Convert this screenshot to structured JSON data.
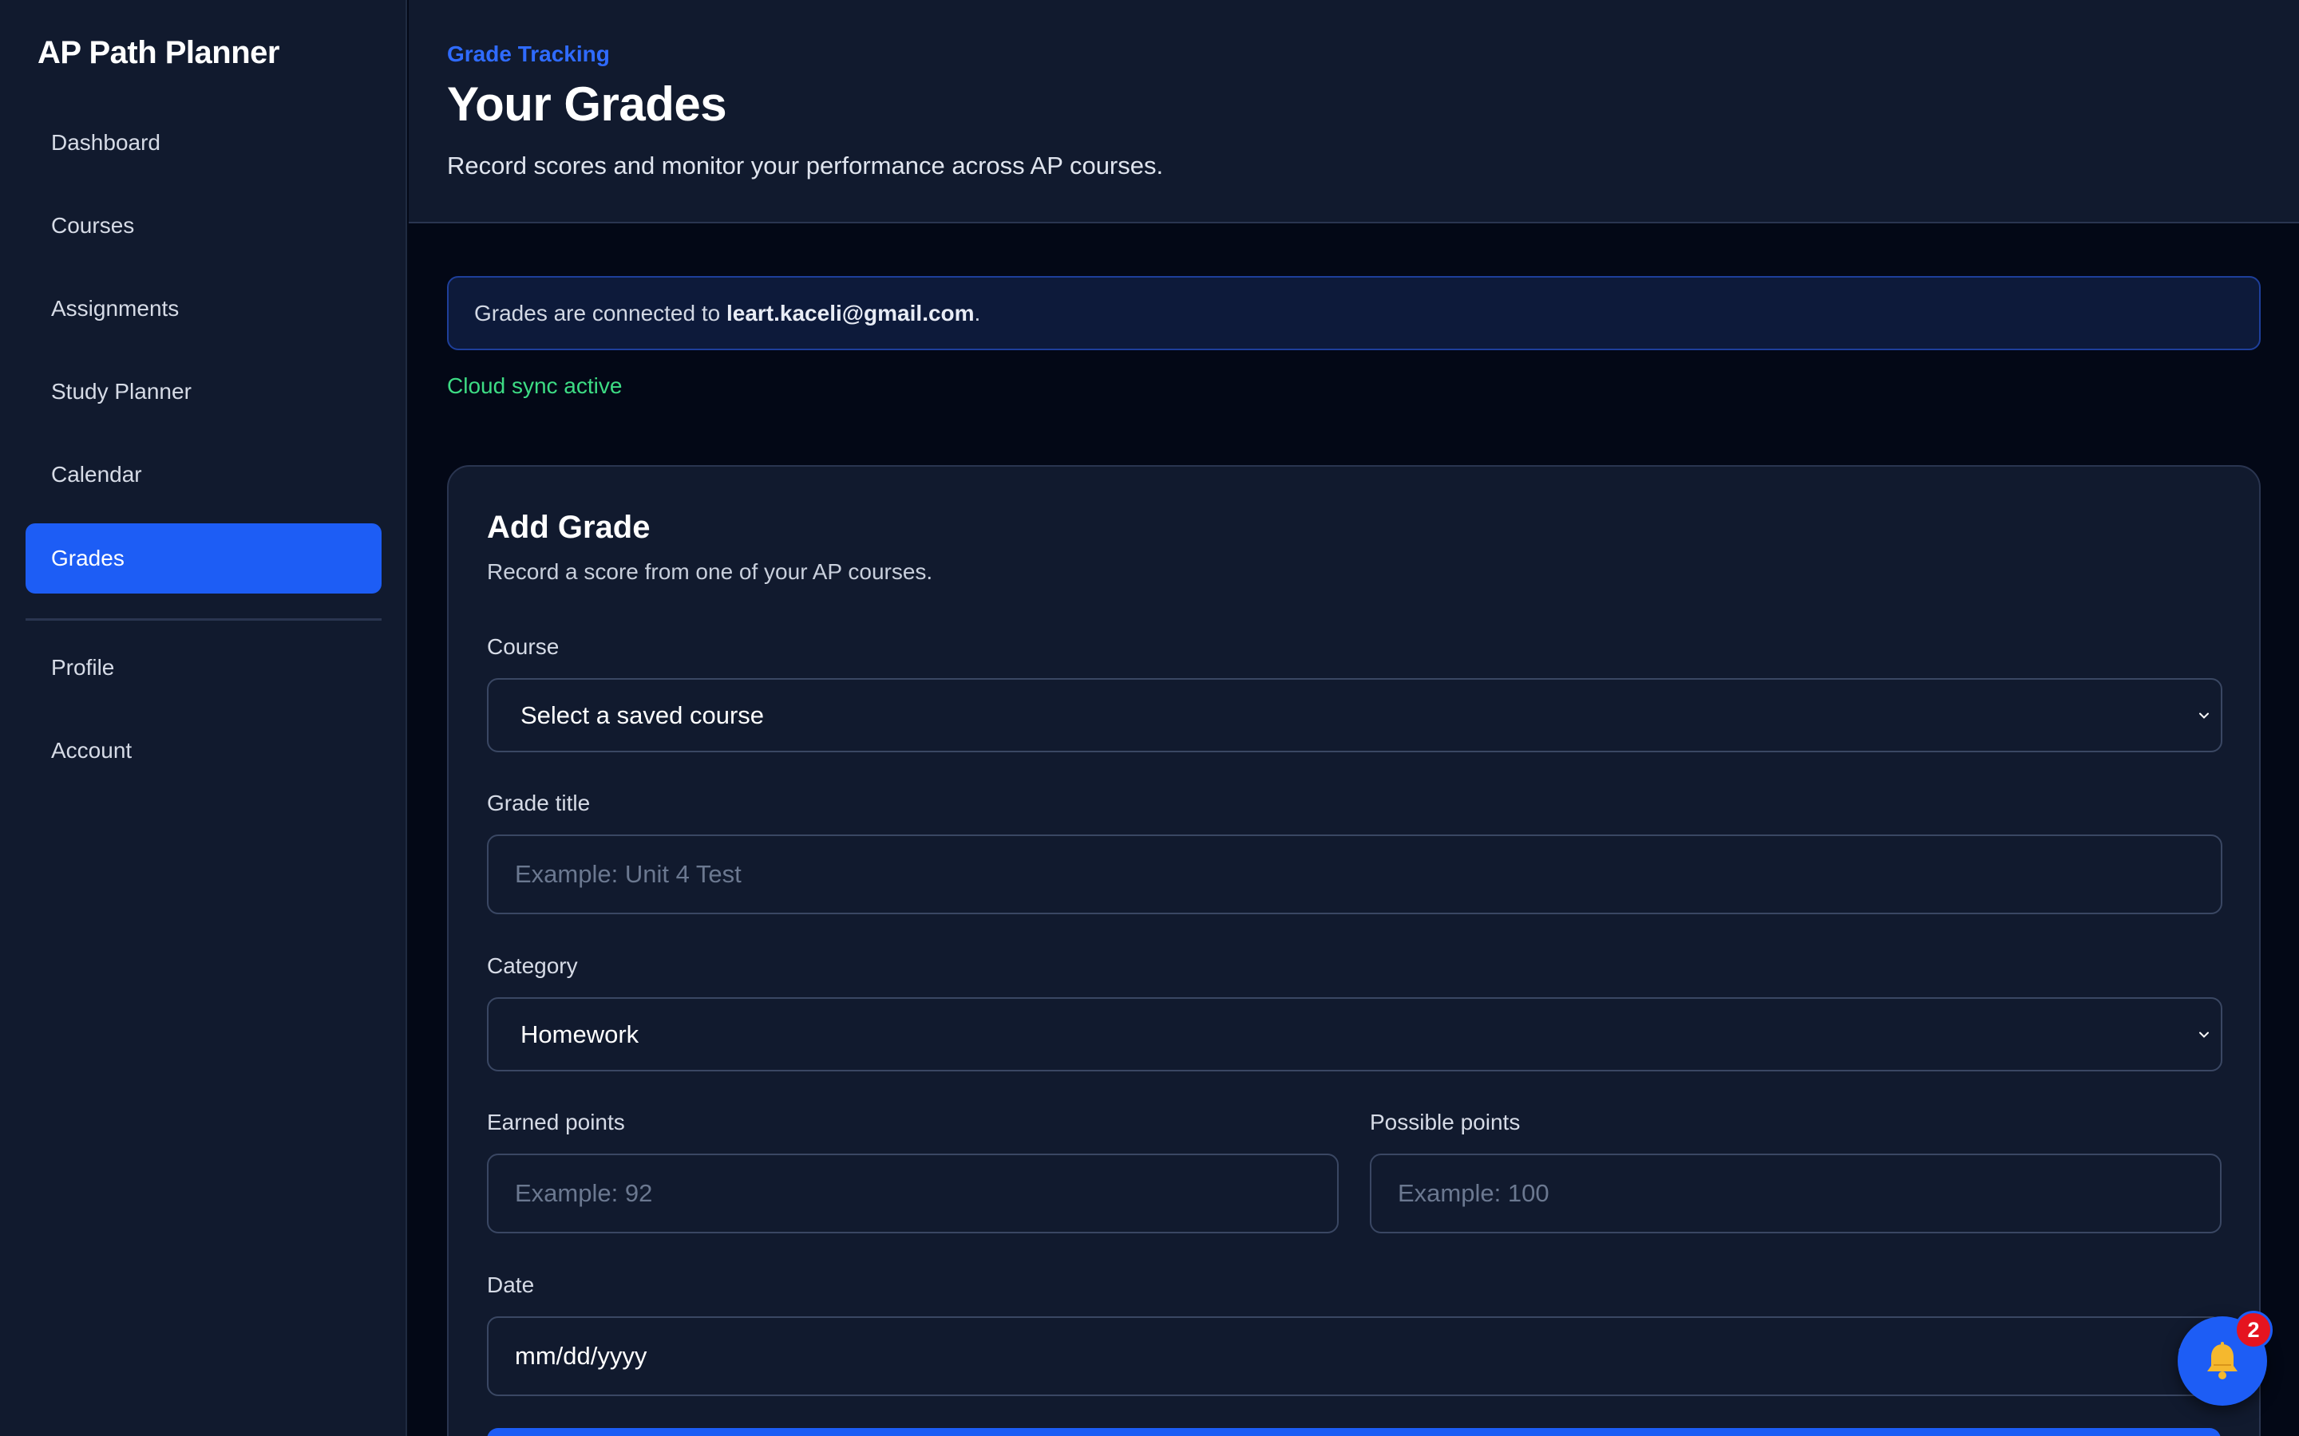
{
  "app": {
    "name": "AP Path Planner"
  },
  "sidebar": {
    "items": [
      {
        "label": "Dashboard"
      },
      {
        "label": "Courses"
      },
      {
        "label": "Assignments"
      },
      {
        "label": "Study Planner"
      },
      {
        "label": "Calendar"
      },
      {
        "label": "Grades",
        "active": true
      }
    ],
    "secondary": [
      {
        "label": "Profile"
      },
      {
        "label": "Account"
      }
    ]
  },
  "header": {
    "eyebrow": "Grade Tracking",
    "title": "Your Grades",
    "subtitle": "Record scores and monitor your performance across AP courses."
  },
  "sync": {
    "prefix": "Grades are connected to ",
    "email": "leart.kaceli@gmail.com",
    "suffix": ".",
    "status": "Cloud sync active"
  },
  "form": {
    "title": "Add Grade",
    "subtitle": "Record a score from one of your AP courses.",
    "course": {
      "label": "Course",
      "value": "Select a saved course"
    },
    "grade_title": {
      "label": "Grade title",
      "placeholder": "Example: Unit 4 Test"
    },
    "category": {
      "label": "Category",
      "value": "Homework"
    },
    "earned": {
      "label": "Earned points",
      "placeholder": "Example: 92"
    },
    "possible": {
      "label": "Possible points",
      "placeholder": "Example: 100"
    },
    "date": {
      "label": "Date",
      "value": "mm/dd/yyyy"
    }
  },
  "notifications": {
    "count": "2",
    "icon": "bell-icon"
  },
  "colors": {
    "accent": "#1d5df5",
    "success": "#3ddc84",
    "badge": "#e5141f",
    "sidebar_bg": "#111a2e",
    "page_bg": "#030816"
  }
}
